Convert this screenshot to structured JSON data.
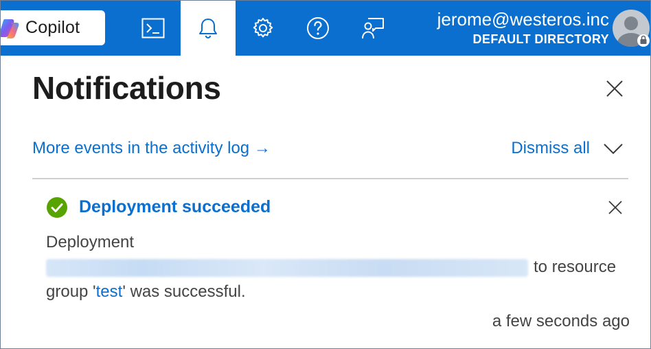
{
  "topbar": {
    "copilot_label": "Copilot",
    "icons": [
      "cloud-shell-icon",
      "bell-icon",
      "gear-icon",
      "help-icon",
      "feedback-icon"
    ],
    "active_icon": "bell-icon",
    "account": {
      "email": "jerome@westeros.inc",
      "directory": "DEFAULT DIRECTORY"
    },
    "colors": {
      "bar": "#0a6fcf",
      "accent": "#0a6fcf",
      "success": "#57a300"
    }
  },
  "panel": {
    "title": "Notifications",
    "activity_link": "More events in the activity log →",
    "dismiss_all": "Dismiss all"
  },
  "notification": {
    "status": "success",
    "title": "Deployment succeeded",
    "body_prefix": "Deployment",
    "body_middle": "to resource group '",
    "resource_group": "test",
    "body_suffix": "' was successful.",
    "time": "a few seconds ago"
  }
}
